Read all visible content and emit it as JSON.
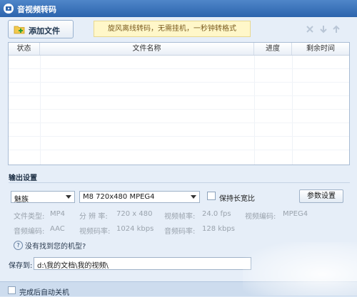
{
  "window": {
    "title": "音视频转码",
    "app_icon": "film-icon"
  },
  "toolbar": {
    "add_file_label": "添加文件",
    "promo_text": "旋风离线转码，无需挂机，一秒钟转格式",
    "icons": [
      "close-icon",
      "arrow-down-icon",
      "arrow-up-icon"
    ]
  },
  "file_list": {
    "columns": [
      "状态",
      "文件名称",
      "进度",
      "剩余时间"
    ],
    "rows": []
  },
  "output": {
    "section_title": "输出设置",
    "device": "魅族",
    "format": "M8 720x480 MPEG4",
    "keep_ratio_label": "保持长宽比",
    "keep_ratio_checked": false,
    "param_button": "参数设置",
    "info": [
      {
        "label": "文件类型:",
        "value": "MP4"
      },
      {
        "label": "分 辨 率:",
        "value": "720 x 480"
      },
      {
        "label": "视频帧率:",
        "value": "24.0 fps"
      },
      {
        "label": "视频编码:",
        "value": "MPEG4"
      },
      {
        "label": "音频编码:",
        "value": "AAC"
      },
      {
        "label": "视频码率:",
        "value": "1024 kbps"
      },
      {
        "label": "音频码率:",
        "value": "128 kbps"
      }
    ],
    "help_text": "没有找到您的机型?"
  },
  "save": {
    "label": "保存到:",
    "path": "d:\\我的文档\\我的视频\\"
  },
  "footer": {
    "shutdown_label": "完成后自动关机",
    "shutdown_checked": false
  }
}
